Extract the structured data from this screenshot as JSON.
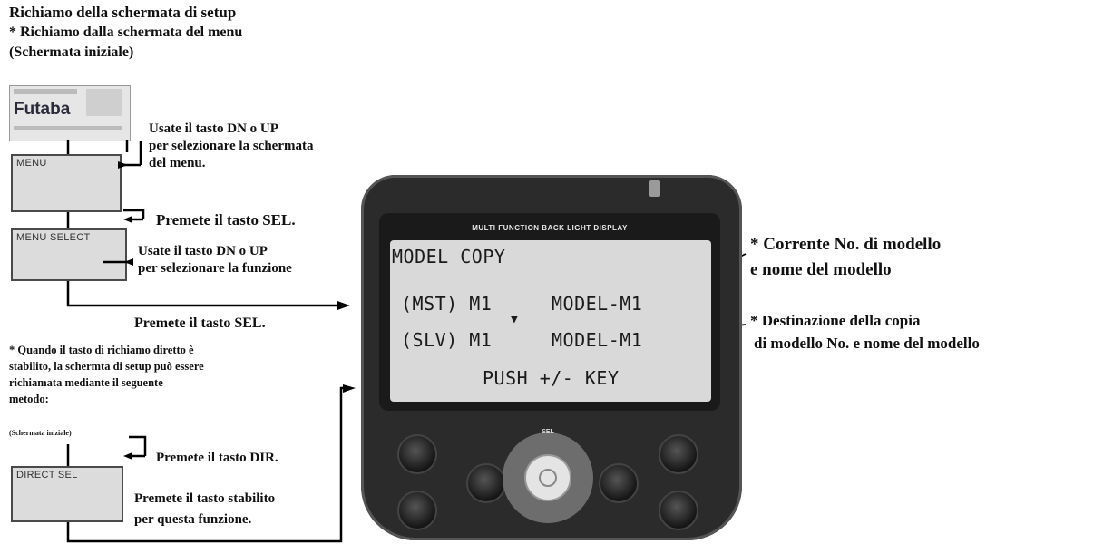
{
  "left": {
    "heading1": "Richiamo della schermata di setup",
    "heading2": "* Richiamo dalla schermata del menu",
    "heading3": "(Schermata iniziale)",
    "initial_logo": "Futaba",
    "step1_line1": "Usate il tasto DN o UP",
    "step1_line2": "per selezionare la schermata",
    "step1_line3": "del menu.",
    "box_menu": "MENU",
    "step2": "Premete il tasto SEL.",
    "box_menu_select": "MENU SELECT",
    "step3_line1": "Usate il tasto DN o UP",
    "step3_line2": "per selezionare la funzione",
    "step4": "Premete il tasto SEL.",
    "note_line1": "* Quando il tasto di richiamo diretto è",
    "note_line2": "stabilito, la schermta di setup può essere",
    "note_line3": "richiamata mediante il seguente",
    "note_line4": "metodo:",
    "small_label": "(Schermata iniziale)",
    "step5": "Premete il tasto DIR.",
    "box_direct_sel": "DIRECT SEL",
    "step6_line1": "Premete il tasto stabilito",
    "step6_line2": "per questa funzione."
  },
  "device": {
    "header": "MULTI FUNCTION BACK LIGHT DISPLAY",
    "screen_title": "MODEL COPY",
    "mst_label": "(MST) M1",
    "mst_name": "MODEL-M1",
    "arrow": "▼",
    "slv_label": "(SLV) M1",
    "slv_name": "MODEL-M1",
    "push_line": "PUSH +/- KEY",
    "key_sel": "SEL"
  },
  "right": {
    "callout1_line1": "* Corrente No. di modello",
    "callout1_line2": "e nome del modello",
    "callout2_line1": "* Destinazione della copia",
    "callout2_line2": "di modello No. e nome del modello"
  }
}
